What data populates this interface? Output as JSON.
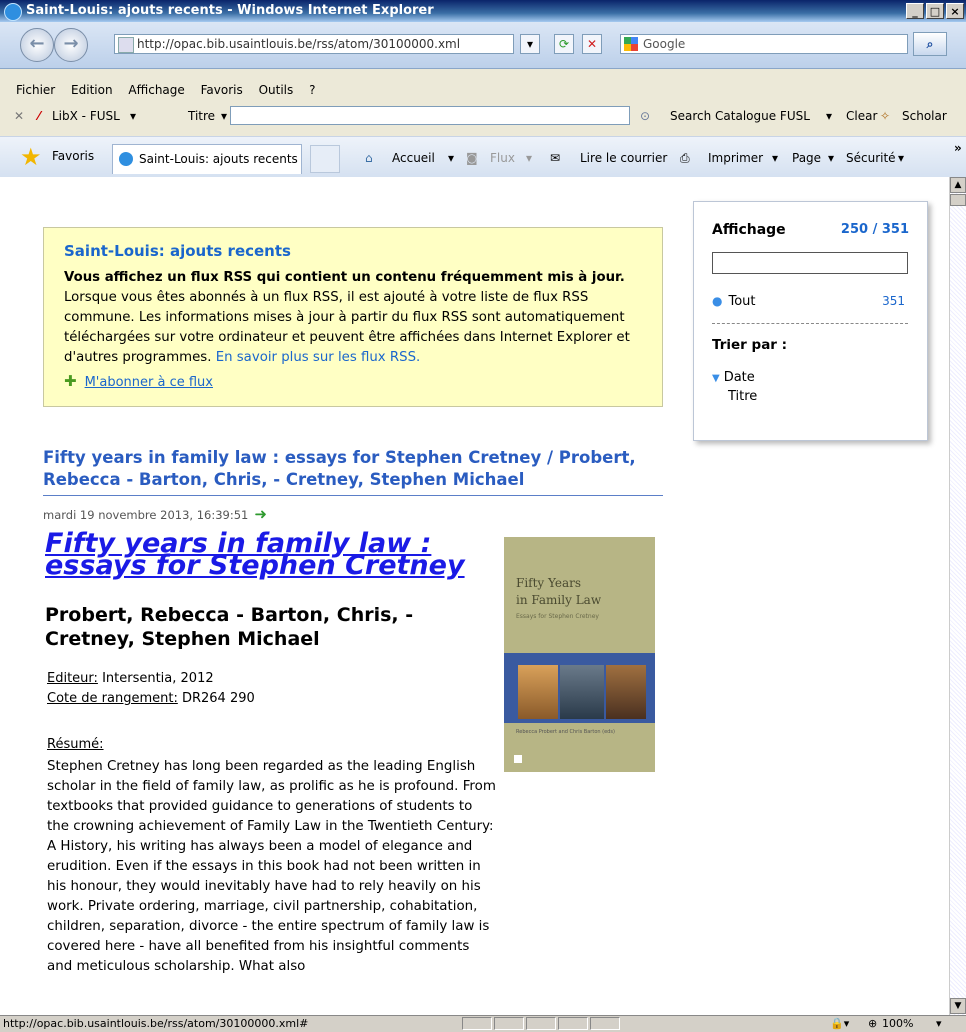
{
  "window": {
    "title": "Saint-Louis: ajouts recents - Windows Internet Explorer"
  },
  "nav": {
    "url": "http://opac.bib.usaintlouis.be/rss/atom/30100000.xml",
    "search_provider": "Google"
  },
  "menu": [
    "Fichier",
    "Edition",
    "Affichage",
    "Favoris",
    "Outils",
    "?"
  ],
  "libx": {
    "brand": "LibX - FUSL",
    "field": "Titre",
    "search_label": "Search Catalogue FUSL",
    "clear": "Clear",
    "scholar": "Scholar"
  },
  "favbar": {
    "favorites": "Favoris",
    "tab": "Saint-Louis: ajouts recents",
    "commands": [
      "Accueil",
      "Flux",
      "Lire le courrier",
      "Imprimer",
      "Page",
      "Sécurité"
    ]
  },
  "rss": {
    "title": "Saint-Louis: ajouts recents",
    "headline": "Vous affichez un flux RSS qui contient un contenu fréquemment mis à jour.",
    "body": "Lorsque vous êtes abonnés à un flux RSS, il est ajouté à votre liste de flux RSS commune. Les informations mises à jour à partir du flux RSS sont automatiquement téléchargées sur votre ordinateur et peuvent être affichées dans Internet Explorer et d'autres programmes.",
    "learn_more": "En savoir plus sur les flux RSS.",
    "subscribe": "M'abonner à ce flux"
  },
  "sidebar": {
    "heading": "Affichage",
    "count": "250 / 351",
    "all_label": "Tout",
    "all_count": "351",
    "sort_heading": "Trier par :",
    "sort_date": "Date",
    "sort_title": "Titre"
  },
  "entry": {
    "title": "Fifty years in family law : essays for Stephen Cretney / Probert, Rebecca - Barton, Chris, - Cretney, Stephen Michael",
    "date": "mardi 19 novembre 2013, 16:39:51",
    "book_title": "Fifty years in family law : essays for Stephen Cretney",
    "authors": "Probert, Rebecca - Barton, Chris, - Cretney, Stephen Michael",
    "publisher_label": "Editeur:",
    "publisher": "Intersentia, 2012",
    "callno_label": "Cote de rangement:",
    "callno": "DR264 290",
    "summary_label": "Résumé:",
    "summary": "Stephen Cretney has long been regarded as the leading English scholar in the field of family law, as prolific as he is profound. From textbooks that provided guidance to generations of students to the crowning achievement of Family Law in the Twentieth Century: A History, his writing has always been a model of elegance and erudition. Even if the essays in this book had not been written in his honour, they would inevitably have had to rely heavily on his work. Private ordering, marriage, civil partnership, cohabitation, children, separation, divorce - the entire spectrum of family law is covered here - have all benefited from his insightful comments and meticulous scholarship. What also",
    "cover": {
      "title_l1": "Fifty Years",
      "title_l2": "in Family Law",
      "subtitle": "Essays for Stephen Cretney",
      "editors": "Rebecca Probert and Chris Barton (eds)"
    }
  },
  "status": {
    "url": "http://opac.bib.usaintlouis.be/rss/atom/30100000.xml#",
    "zoom": "100%"
  }
}
